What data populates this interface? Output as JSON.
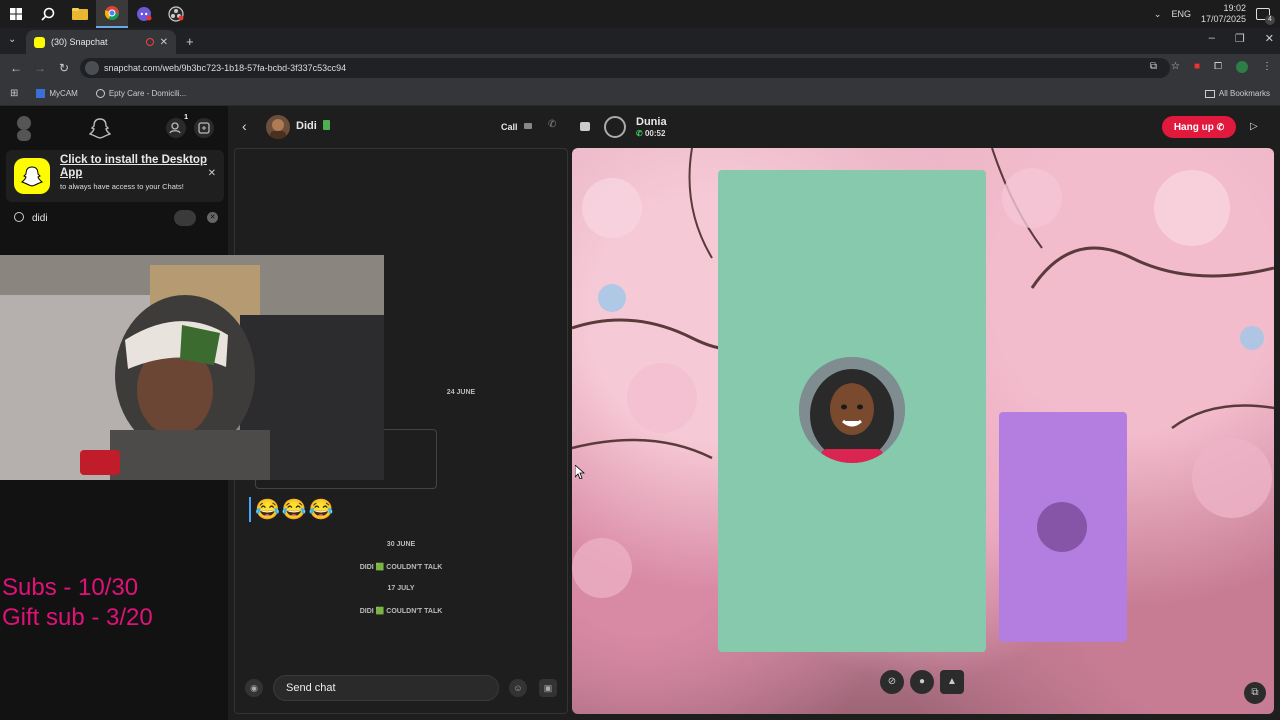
{
  "taskbar": {
    "language": "ENG",
    "time": "19:02",
    "date": "17/07/2025",
    "notification_count": "4"
  },
  "browser": {
    "tab_title": "(30) Snapchat",
    "url": "snapchat.com/web/9b3bc723-1b18-57fa-bcbd-3f337c53cc94",
    "bookmarks": [
      "MyCAM",
      "Epty Care - Domicili..."
    ],
    "all_bookmarks": "All Bookmarks"
  },
  "sidebar": {
    "friend_request_count": "1",
    "install_title": "Click to install the Desktop App",
    "install_subtitle": "to always have access to your Chats!",
    "search_value": "didi"
  },
  "overlay": {
    "subs": "Subs - 10/30",
    "gift_subs": "Gift sub - 3/20"
  },
  "chat": {
    "name": "Didi",
    "call_label": "Call",
    "date_1": "24 JUNE",
    "emojis": "😂😂😂",
    "date_2": "30 JUNE",
    "status_1": "DIDI 🟩 COULDN'T TALK",
    "date_3": "17 JULY",
    "status_2": "DIDI 🟩 COULDN'T TALK",
    "compose_placeholder": "Send chat"
  },
  "call": {
    "caller_name": "Dunia",
    "timer": "00:52",
    "hangup_label": "Hang up"
  },
  "colors": {
    "snap_yellow": "#fffc00",
    "hangup_red": "#e0193d",
    "overlay_pink": "#e0127a",
    "tile_green": "#86c9ad",
    "tile_purple": "#b47ee0"
  }
}
